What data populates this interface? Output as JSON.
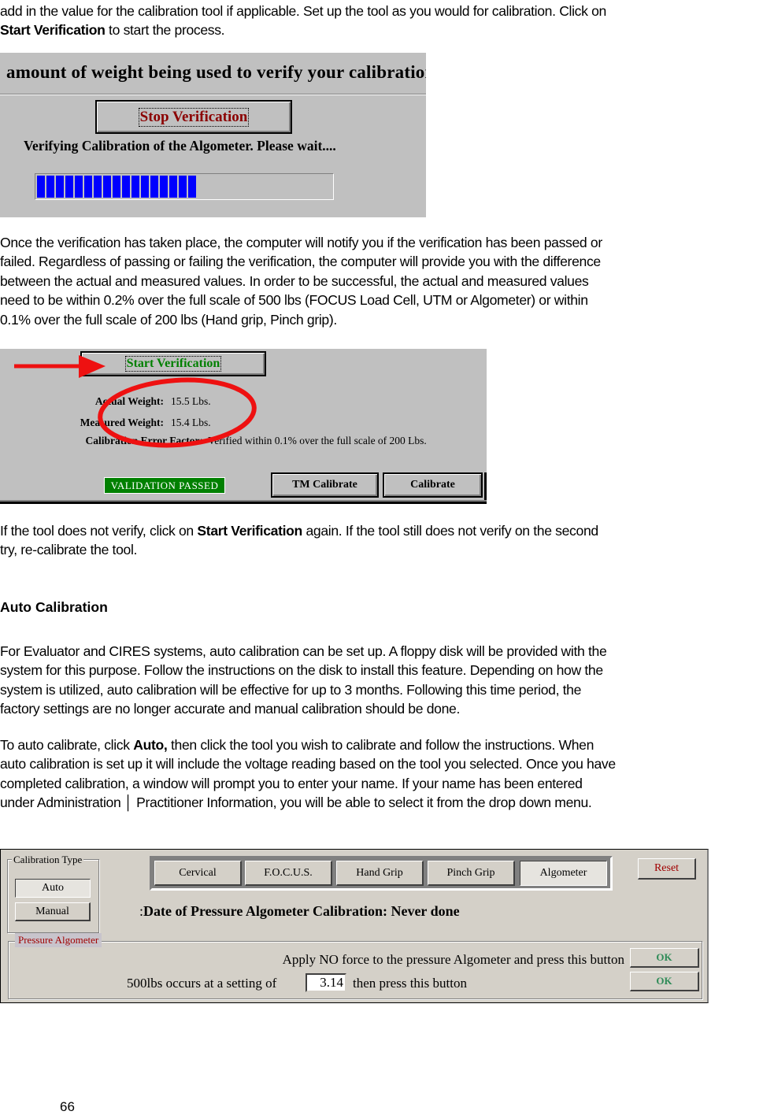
{
  "intro": {
    "line1": "add in the value for the calibration tool if applicable. Set up the tool as you would for calibration. Click on",
    "line2_bold": "Start Verification",
    "line2_rest": " to start the process."
  },
  "verify_screen": {
    "instruction_text": "amount of weight being used to verify your calibration",
    "stop_button": "Stop Verification",
    "stop_button_accel": "S",
    "status_text": "Verifying Calibration of the Algometer.  Please wait....",
    "progress_percent": 56
  },
  "results_paragraph": [
    "Once the verification has taken place, the computer will notify you if the verification has been passed or",
    "failed.  Regardless of passing or failing the verification, the computer will provide you with the difference",
    "between the actual and measured values.  In order to be successful, the actual and measured values",
    "need to be within 0.2% over the full scale of 500 lbs (FOCUS Load Cell, UTM or Algometer) or within",
    "0.1% over the full scale of 200 lbs (Hand grip, Pinch grip)."
  ],
  "result_screen": {
    "start_button": "Start Verification",
    "actual_weight_label": "Actual Weight:",
    "actual_weight_value": "15.5 Lbs.",
    "measured_weight_label": "Measured Weight:",
    "measured_weight_value": "15.4 Lbs.",
    "error_factor_label": "Calibration Error Factor:",
    "error_factor_value": "Verified within 0.1% over the full scale of 200 Lbs.",
    "validation_status": "VALIDATION PASSED",
    "tm_calibrate_button": "TM Calibrate",
    "calibrate_button": "Calibrate",
    "colors": {
      "annotation": "#ee1111",
      "passed": "#008000"
    }
  },
  "retry_paragraph": {
    "part1": "If the tool does not verify, click on ",
    "bold": "Start Verification",
    "part2": " again. If the tool still does not verify on the second",
    "line2": "try, re-calibrate the tool."
  },
  "section_heading": "Auto Calibration",
  "auto_paragraph": [
    "For Evaluator and CIRES systems, auto calibration can be set up. A floppy disk will be provided with the",
    "system for this purpose. Follow the instructions on the disk to install this feature. Depending on how the",
    "system is utilized, auto calibration will be effective for up to 3 months. Following this time period, the",
    "factory settings are no longer accurate and manual calibration should be done."
  ],
  "auto_steps_paragraph": {
    "part1": "To auto calibrate, click ",
    "bold": "Auto,",
    "part2": " then click the tool you wish to calibrate and follow the instructions. When",
    "line2": "auto calibration is set up it will include the voltage reading based on the tool you selected. Once you have",
    "line3": "completed calibration, a window will prompt you to enter your name. If your name has been entered",
    "line4": "under Administration │ Practitioner Information, you will be able to select it from the drop down menu."
  },
  "calibration_screen": {
    "calibration_type_legend": "Calibration Type",
    "auto_button": "Auto",
    "manual_button": "Manual",
    "tools": [
      "Cervical",
      "F.O.C.U.S.",
      "Hand Grip",
      "Pinch Grip",
      "Algometer"
    ],
    "selected_tool": "Algometer",
    "reset_button": "Reset",
    "date_label": "Date of Pressure Algometer Calibration: Never done",
    "group_legend": "Pressure Algometer",
    "zero_instruction": "Apply NO force to the pressure Algometer and press this button",
    "ok_button": "OK",
    "setting_prefix": "500lbs occurs at a setting of",
    "setting_value": "3.14",
    "setting_suffix": "then press this button",
    "colors": {
      "legend": "#a00000",
      "reset": "#a00000",
      "ok": "#2e8b57"
    }
  },
  "page_number": "66"
}
